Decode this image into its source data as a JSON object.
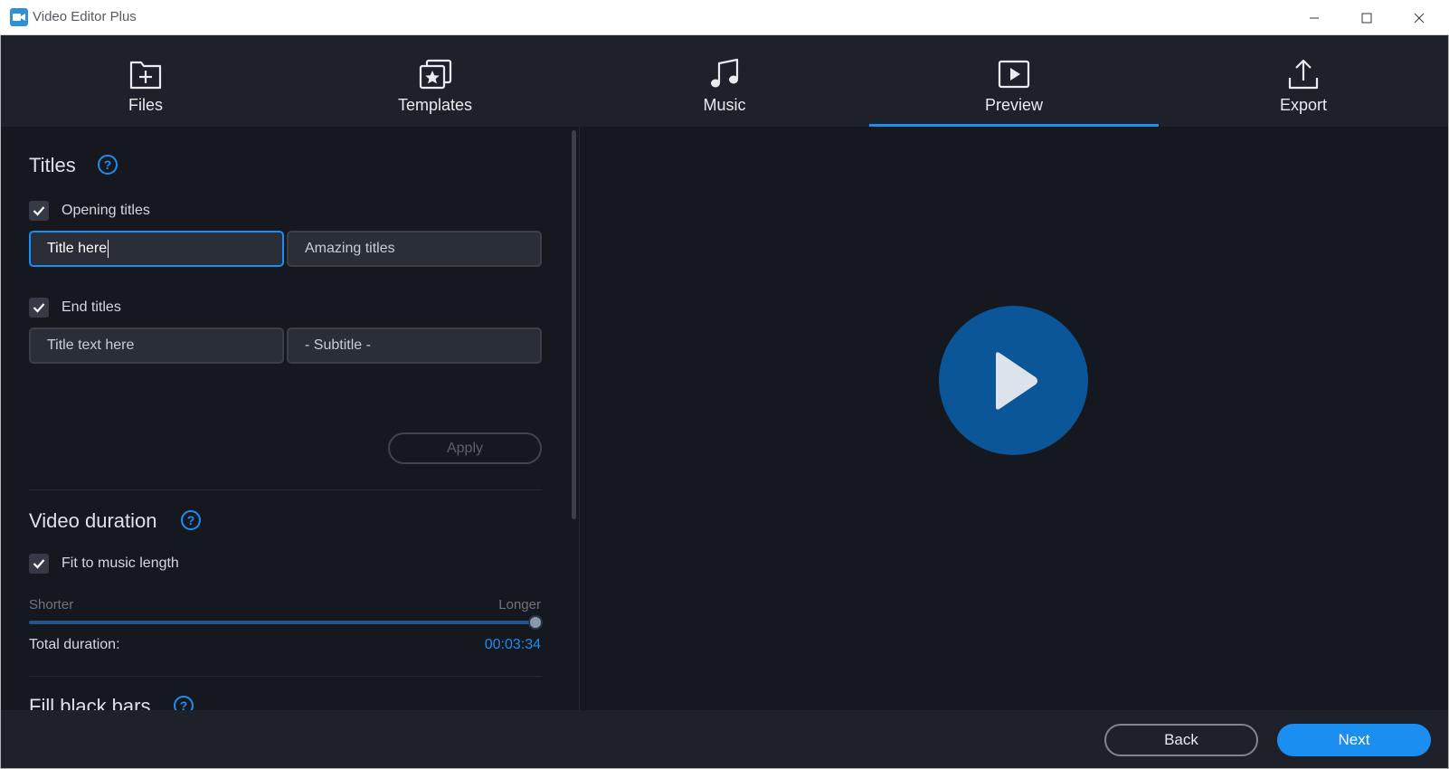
{
  "window": {
    "title": "Video Editor Plus",
    "icon": "video-camera-icon",
    "controls": [
      "minimize-icon",
      "maximize-icon",
      "close-icon"
    ]
  },
  "nav": {
    "tabs": [
      {
        "label": "Files",
        "icon": "file-add-icon",
        "active": false
      },
      {
        "label": "Templates",
        "icon": "templates-star-icon",
        "active": false
      },
      {
        "label": "Music",
        "icon": "music-note-icon",
        "active": false
      },
      {
        "label": "Preview",
        "icon": "play-box-icon",
        "active": true
      },
      {
        "label": "Export",
        "icon": "upload-icon",
        "active": false
      }
    ]
  },
  "titles": {
    "heading": "Titles",
    "opening": {
      "label": "Opening titles",
      "checked": true,
      "title_value": "Title here",
      "subtitle_value": "Amazing titles"
    },
    "ending": {
      "label": "End titles",
      "checked": true,
      "title_value": "Title text here",
      "subtitle_value": "- Subtitle -"
    },
    "apply_label": "Apply"
  },
  "duration": {
    "heading": "Video duration",
    "fit_label": "Fit to music length",
    "fit_checked": true,
    "slider_min_label": "Shorter",
    "slider_max_label": "Longer",
    "slider_level": 1.0,
    "total_label": "Total duration:",
    "total_value": "00:03:34"
  },
  "fill": {
    "heading": "Fill black bars"
  },
  "footer": {
    "back_label": "Back",
    "next_label": "Next"
  },
  "colors": {
    "accent": "#1b8ef1",
    "background": "#15181e",
    "panel": "#1e2129",
    "play_button": "#0a5699"
  }
}
